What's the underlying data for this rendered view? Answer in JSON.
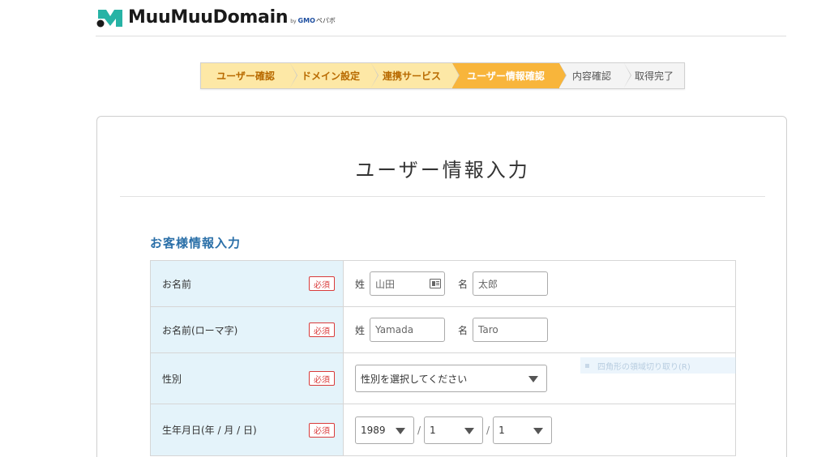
{
  "header": {
    "logo_text": "MuuMuuDomain",
    "logo_by": "by",
    "logo_gmo": "GMO",
    "logo_pepabo": "ペパボ",
    "colors": {
      "logo_green": "#27b3a5",
      "logo_dark": "#1a1a1a"
    }
  },
  "stepper": {
    "steps": [
      {
        "label": "ユーザー確認",
        "state": "done"
      },
      {
        "label": "ドメイン設定",
        "state": "done"
      },
      {
        "label": "連携サービス",
        "state": "done"
      },
      {
        "label": "ユーザー情報確認",
        "state": "active"
      },
      {
        "label": "内容確認",
        "state": "todo"
      },
      {
        "label": "取得完了",
        "state": "todo"
      }
    ],
    "colors": {
      "done": "#fde8a6",
      "active": "#f8b53b",
      "todo": "#f4f4f4"
    }
  },
  "main": {
    "title": "ユーザー情報入力",
    "section_title": "お客様情報入力",
    "required_label": "必須",
    "rows": {
      "name": {
        "label": "お名前",
        "last_label": "姓",
        "last_placeholder": "山田",
        "first_label": "名",
        "first_placeholder": "太郎"
      },
      "name_roman": {
        "label": "お名前(ローマ字)",
        "last_label": "姓",
        "last_placeholder": "Yamada",
        "first_label": "名",
        "first_placeholder": "Taro"
      },
      "gender": {
        "label": "性別",
        "selected": "性別を選択してください"
      },
      "birthday": {
        "label": "生年月日(年 / 月 / 日)",
        "year": "1989",
        "month": "1",
        "day": "1",
        "separator": "/"
      }
    },
    "colors": {
      "label_bg": "#e4f3fa",
      "section_title": "#2a6fa8",
      "required": "#d93b3b"
    }
  },
  "ghost_tooltip": {
    "text": "四角形の領域切り取り(R)"
  }
}
